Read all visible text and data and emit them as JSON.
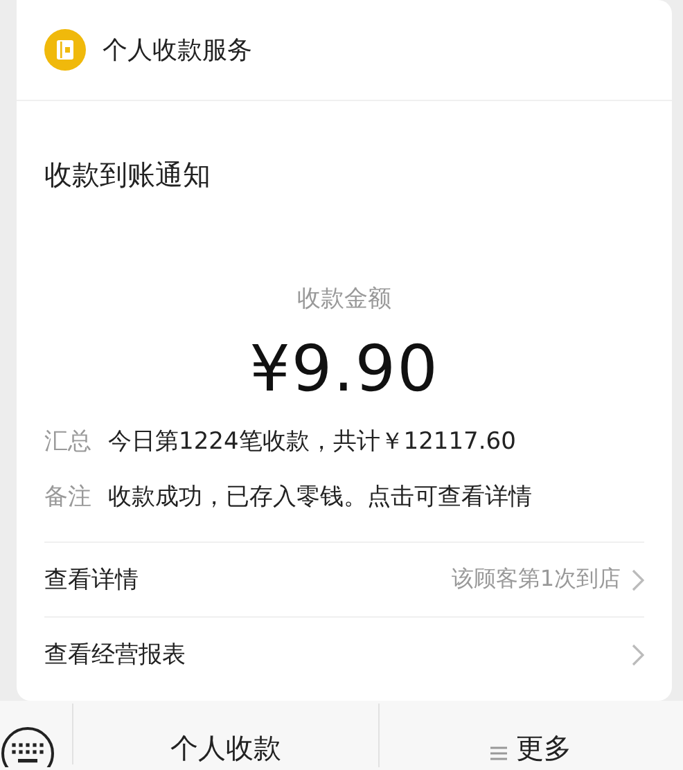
{
  "header": {
    "title": "个人收款服务"
  },
  "notice": {
    "title": "收款到账通知",
    "amount_label": "收款金额",
    "amount": "¥9.90",
    "details": [
      {
        "label": "汇总",
        "value": "今日第1224笔收款，共计￥12117.60"
      },
      {
        "label": "备注",
        "value": "收款成功，已存入零钱。点击可查看详情"
      }
    ]
  },
  "links": [
    {
      "label": "查看详情",
      "note": "该顾客第1次到店"
    },
    {
      "label": "查看经营报表"
    }
  ],
  "bottom_bar": {
    "menus": [
      {
        "label": "个人收款",
        "kind": "plain"
      },
      {
        "label": "更多",
        "kind": "menu"
      }
    ]
  }
}
